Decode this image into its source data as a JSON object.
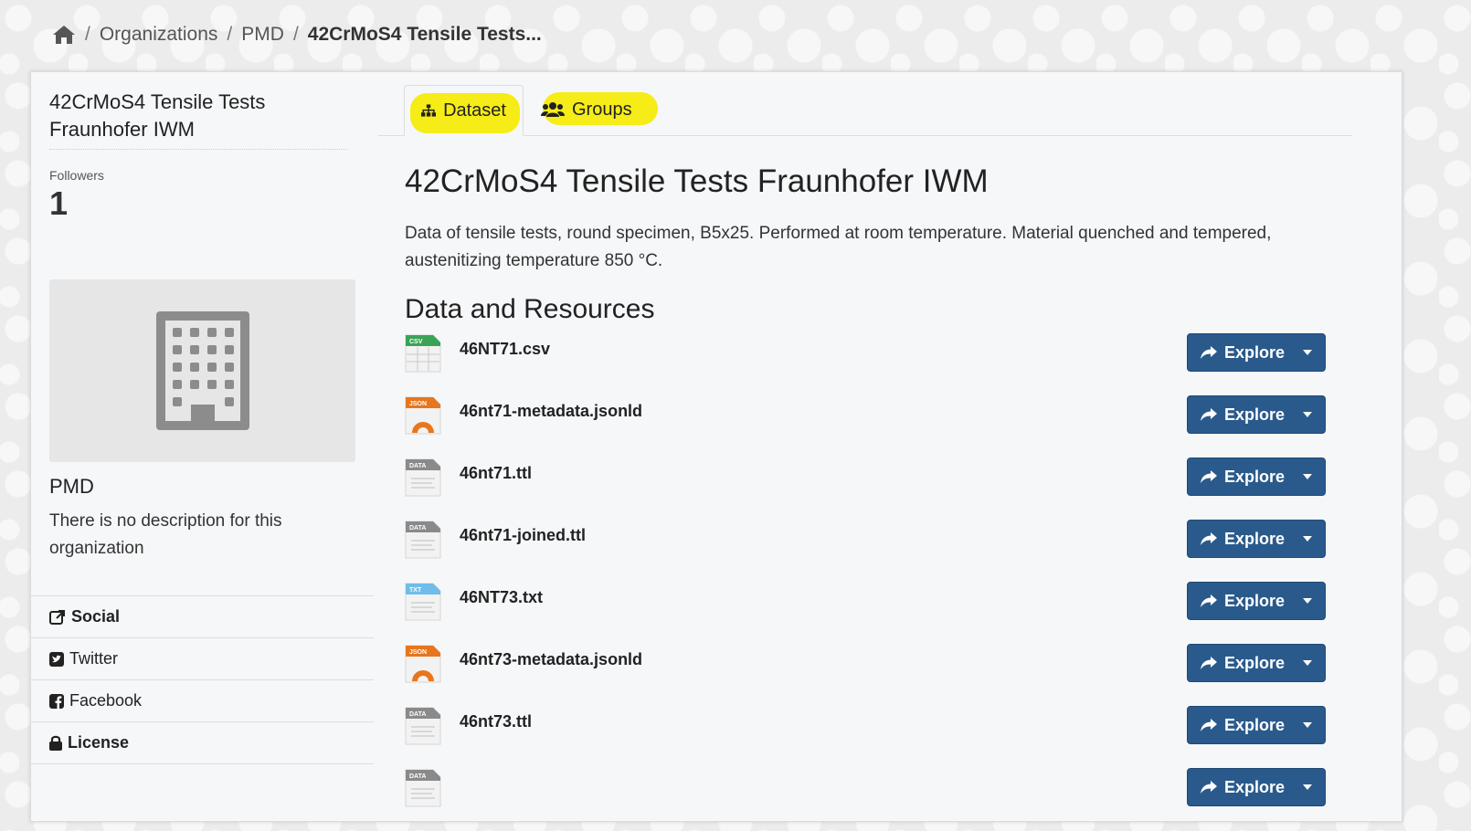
{
  "breadcrumb": {
    "items": [
      "Organizations",
      "PMD"
    ],
    "current": "42CrMoS4 Tensile Tests..."
  },
  "sidebar": {
    "title": "42CrMoS4 Tensile Tests Fraunhofer IWM",
    "followers_label": "Followers",
    "followers_count": "1",
    "org_name": "PMD",
    "org_description": "There is no description for this organization",
    "social_heading": "Social",
    "twitter": "Twitter",
    "facebook": "Facebook",
    "license_heading": "License"
  },
  "tabs": {
    "dataset": "Dataset",
    "groups": "Groups"
  },
  "dataset": {
    "title": "42CrMoS4 Tensile Tests Fraunhofer IWM",
    "description": "Data of tensile tests, round specimen, B5x25. Performed at room temperature. Material quenched and tempered, austenitizing temperature 850 °C."
  },
  "resources": {
    "heading": "Data and Resources",
    "explore_label": "Explore",
    "items": [
      {
        "name": "46NT71.csv",
        "format": "CSV",
        "icon": "csv-file-icon"
      },
      {
        "name": "46nt71-metadata.jsonld",
        "format": "JSON",
        "icon": "json-file-icon"
      },
      {
        "name": "46nt71.ttl",
        "format": "DATA",
        "icon": "data-file-icon"
      },
      {
        "name": "46nt71-joined.ttl",
        "format": "DATA",
        "icon": "data-file-icon"
      },
      {
        "name": "46NT73.txt",
        "format": "TXT",
        "icon": "txt-file-icon"
      },
      {
        "name": "46nt73-metadata.jsonld",
        "format": "JSON",
        "icon": "json-file-icon"
      },
      {
        "name": "46nt73.ttl",
        "format": "DATA",
        "icon": "data-file-icon"
      },
      {
        "name": "",
        "format": "DATA",
        "icon": "data-file-icon"
      }
    ]
  },
  "colors": {
    "button": "#2a5a8c",
    "highlight": "#f5ec18",
    "csv": "#3aa357",
    "json": "#e8761c",
    "data": "#8a8a8a",
    "txt": "#6fbde8"
  }
}
